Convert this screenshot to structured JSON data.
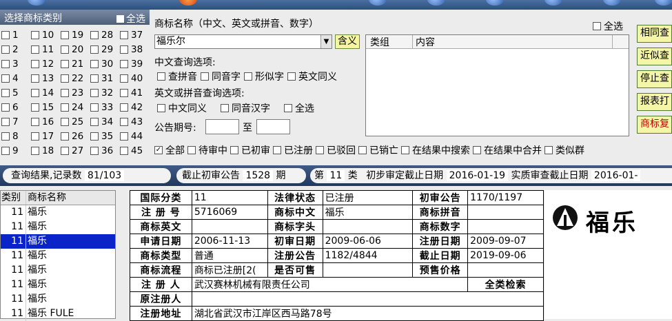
{
  "category_panel": {
    "title": "选择商标类别",
    "select_all": "全选",
    "rows": [
      [
        "1",
        "10",
        "19",
        "28",
        "37"
      ],
      [
        "2",
        "11",
        "20",
        "29",
        "38"
      ],
      [
        "3",
        "12",
        "21",
        "30",
        "39"
      ],
      [
        "4",
        "13",
        "22",
        "31",
        "40"
      ],
      [
        "5",
        "14",
        "23",
        "32",
        "41"
      ],
      [
        "6",
        "15",
        "24",
        "33",
        "42"
      ],
      [
        "7",
        "16",
        "25",
        "34",
        "43"
      ],
      [
        "8",
        "17",
        "26",
        "35",
        "44"
      ],
      [
        "9",
        "18",
        "27",
        "36",
        "45"
      ]
    ]
  },
  "search": {
    "name_label": "商标名称（中文、英文或拼音、数字）",
    "name_value": "福乐尔",
    "contain_button": "含义",
    "select_all": "全选",
    "cn_options_title": "中文查询选项:",
    "cn_options": [
      "查拼音",
      "同音字",
      "形似字",
      "英文同义"
    ],
    "en_options_title": "英文或拼音查询选项:",
    "en_options": [
      "中文同义",
      "同音汉字",
      "全选"
    ],
    "period_label": "公告期号:",
    "period_to": "至"
  },
  "result_box": {
    "col_group": "类组",
    "col_content": "内容"
  },
  "right_buttons": [
    "相同查",
    "近似查",
    "停止查",
    "报表打",
    "商标复"
  ],
  "filters": [
    "全部",
    "待审中",
    "已初审",
    "已注册",
    "已驳回",
    "已销亡",
    "在结果中搜索",
    "在结果中合并",
    "类似群"
  ],
  "status_bar": {
    "query_result_label": "查询结果,记录数",
    "query_result_value": "81/103",
    "cutoff_label": "截止初审公告",
    "cutoff_value": "1528",
    "cutoff_unit": "期",
    "class_prefix": "第",
    "class_value": "11",
    "class_suffix": "类",
    "prelim_label": "初步审定截止日期",
    "prelim_value": "2016-01-19",
    "subst_label": "实质审查截止日期",
    "subst_value": "2016-01-"
  },
  "list": {
    "header": [
      "类别",
      "商标名称"
    ],
    "rows": [
      {
        "cls": "11",
        "name": "福乐"
      },
      {
        "cls": "11",
        "name": "福乐"
      },
      {
        "cls": "11",
        "name": "福乐"
      },
      {
        "cls": "11",
        "name": "福乐"
      },
      {
        "cls": "11",
        "name": "福乐"
      },
      {
        "cls": "11",
        "name": "福乐"
      },
      {
        "cls": "11",
        "name": "福乐"
      },
      {
        "cls": "11",
        "name": "福乐 FULE"
      }
    ],
    "selected_index": 2
  },
  "detail": {
    "intl_class_k": "国际分类",
    "intl_class_v": "11",
    "legal_k": "法律状态",
    "legal_v": "已注册",
    "prelim_k": "初审公告",
    "prelim_v": "1170/1197",
    "regno_k": "注 册 号",
    "regno_v": "5716069",
    "name_cn_k": "商标中文",
    "name_cn_v": "福乐",
    "pinyin_k": "商标拼音",
    "pinyin_v": "",
    "name_en_k": "商标英文",
    "name_en_v": "",
    "initial_k": "商标字头",
    "initial_v": "",
    "digits_k": "商标数字",
    "digits_v": "",
    "apply_k": "申请日期",
    "apply_v": "2006-11-13",
    "prelim_date_k": "初审日期",
    "prelim_date_v": "2009-06-06",
    "reg_date_k": "注册日期",
    "reg_date_v": "2009-09-07",
    "type_k": "商标类型",
    "type_v": "普通",
    "reg_notice_k": "注册公告",
    "reg_notice_v": "1182/4844",
    "expire_k": "截止日期",
    "expire_v": "2019-09-06",
    "flow_k": "商标流程",
    "flow_v": "商标已注册[2(",
    "sellable_k": "是否可售",
    "sellable_v": "",
    "price_k": "预售价格",
    "price_v": "",
    "registrant_k": "注 册 人",
    "registrant_v": "武汉赛林机械有限责任公司",
    "all_search": "全类检索",
    "orig_reg_k": "原注册人",
    "orig_reg_v": "",
    "address_k": "注册地址",
    "address_v": "湖北省武汉市江岸区西马路78号"
  },
  "logo": {
    "text": "福乐"
  }
}
